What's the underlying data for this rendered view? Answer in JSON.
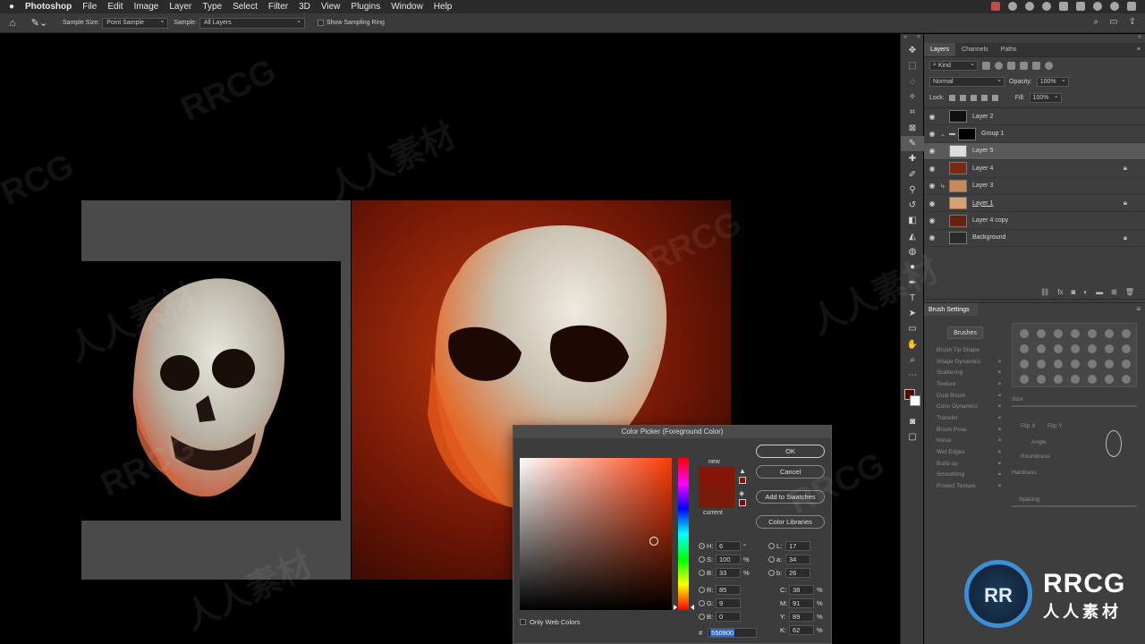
{
  "menubar": {
    "apple": "",
    "app": "Photoshop",
    "items": [
      "File",
      "Edit",
      "Image",
      "Layer",
      "Type",
      "Select",
      "Filter",
      "3D",
      "View",
      "Plugins",
      "Window",
      "Help"
    ]
  },
  "options": {
    "sample_size_label": "Sample Size:",
    "sample_size_value": "Point Sample",
    "sample_label": "Sample:",
    "sample_value": "All Layers",
    "show_ring": "Show Sampling Ring"
  },
  "layers_panel": {
    "tabs": [
      "Layers",
      "Channels",
      "Paths"
    ],
    "kind": "Kind",
    "blend": "Normal",
    "opacity_label": "Opacity:",
    "opacity": "100%",
    "lock_label": "Lock:",
    "fill_label": "Fill:",
    "fill": "100%",
    "layers": [
      {
        "name": "Layer 2",
        "thumb": "#111111",
        "locked": false,
        "selected": false
      },
      {
        "name": "Group 1",
        "thumb": "#000000",
        "locked": false,
        "selected": false,
        "group": true
      },
      {
        "name": "Layer 5",
        "thumb": "#dddddd",
        "locked": false,
        "selected": true
      },
      {
        "name": "Layer 4",
        "thumb": "#7a2a10",
        "locked": true,
        "selected": false
      },
      {
        "name": "Layer 3",
        "thumb": "#c98a5a",
        "locked": false,
        "selected": false,
        "clip": true
      },
      {
        "name": "Layer 1",
        "thumb": "#d9a070",
        "locked": true,
        "selected": false,
        "underline": true
      },
      {
        "name": "Layer 4 copy",
        "thumb": "#6a2210",
        "locked": false,
        "selected": false
      },
      {
        "name": "Background",
        "thumb": "#2a2a2a",
        "locked": true,
        "selected": false
      }
    ]
  },
  "brush_panel": {
    "title": "Brush Settings",
    "brushes_button": "Brushes",
    "options": [
      "Brush Tip Shape",
      "Shape Dynamics",
      "Scattering",
      "Texture",
      "Dual Brush",
      "Color Dynamics",
      "Transfer",
      "Brush Pose",
      "Noise",
      "Wet Edges",
      "Build-up",
      "Smoothing",
      "Protect Texture"
    ],
    "labels": {
      "size": "Size",
      "flip_x": "Flip X",
      "flip_y": "Flip Y",
      "angle": "Angle",
      "roundness": "Roundness",
      "hardness": "Hardness",
      "spacing": "Spacing"
    }
  },
  "color_picker": {
    "title": "Color Picker (Foreground Color)",
    "new_label": "new",
    "current_label": "current",
    "buttons": {
      "ok": "OK",
      "cancel": "Cancel",
      "add": "Add to Swatches",
      "libraries": "Color Libraries"
    },
    "hsb": {
      "h": "6",
      "s": "100",
      "b": "33"
    },
    "rgb": {
      "r": "85",
      "g": "9",
      "b": "0"
    },
    "lab": {
      "l": "17",
      "a": "34",
      "b": "26"
    },
    "cmyk": {
      "c": "38",
      "m": "91",
      "y": "89",
      "k": "62"
    },
    "hex": "550900",
    "only_web": "Only Web Colors",
    "colors": {
      "new": "#851508",
      "current": "#7a1a0a",
      "foreground": "#550900"
    }
  },
  "watermark": {
    "brand": "RRCG",
    "sub": "人人素材",
    "logo": "RR"
  }
}
